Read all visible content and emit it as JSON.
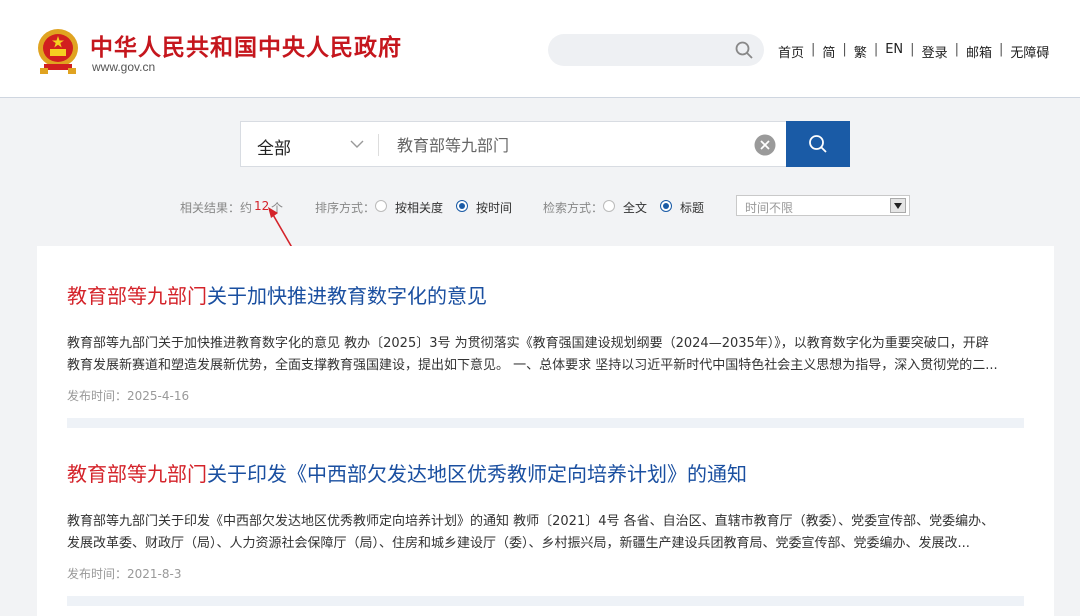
{
  "header": {
    "site_title": "中华人民共和国中央人民政府",
    "site_url": "www.gov.cn",
    "nav": [
      "首页",
      "简",
      "繁",
      "EN",
      "登录",
      "邮箱",
      "无障碍"
    ],
    "nav_separator": "|"
  },
  "search": {
    "scope": "全部",
    "query": "教育部等九部门",
    "icons": {
      "search": "search-icon",
      "clear": "clear-icon",
      "dropdown": "chevron-down-icon"
    }
  },
  "filters": {
    "result_prefix": "相关结果：约",
    "result_count": "12",
    "result_suffix": "个",
    "sort_label": "排序方式：",
    "sort_options": [
      "按相关度",
      "按时间"
    ],
    "sort_selected": "按时间",
    "mode_label": "检索方式：",
    "mode_options": [
      "全文",
      "标题"
    ],
    "mode_selected": "标题",
    "time_range": "时间不限"
  },
  "results": [
    {
      "title_highlight": "教育部等九部门",
      "title_rest": "关于加快推进教育数字化的意见",
      "snippet_line1": "教育部等九部门关于加快推进教育数字化的意见 教办〔2025〕3号 为贯彻落实《教育强国建设规划纲要（2024—2035年）》，以教育数字化为重要突破口，开辟",
      "snippet_line2": "教育发展新赛道和塑造发展新优势，全面支撑教育强国建设，提出如下意见。 一、总体要求 坚持以习近平新时代中国特色社会主义思想为指导，深入贯彻党的二...",
      "date": "发布时间：2025-4-16"
    },
    {
      "title_highlight": "教育部等九部门",
      "title_rest": "关于印发《中西部欠发达地区优秀教师定向培养计划》的通知",
      "snippet_line1": "教育部等九部门关于印发《中西部欠发达地区优秀教师定向培养计划》的通知 教师〔2021〕4号 各省、自治区、直辖市教育厅（教委）、党委宣传部、党委编办、",
      "snippet_line2": "发展改革委、财政厅（局）、人力资源社会保障厅（局）、住房和城乡建设厅（委）、乡村振兴局，新疆生产建设兵团教育局、党委宣传部、党委编办、发展改...",
      "date": "发布时间：2021-8-3"
    }
  ],
  "colors": {
    "brand_red": "#c5161d",
    "highlight_red": "#d4232a",
    "link_blue": "#1a4fa0",
    "search_button": "#1a5ba6"
  }
}
